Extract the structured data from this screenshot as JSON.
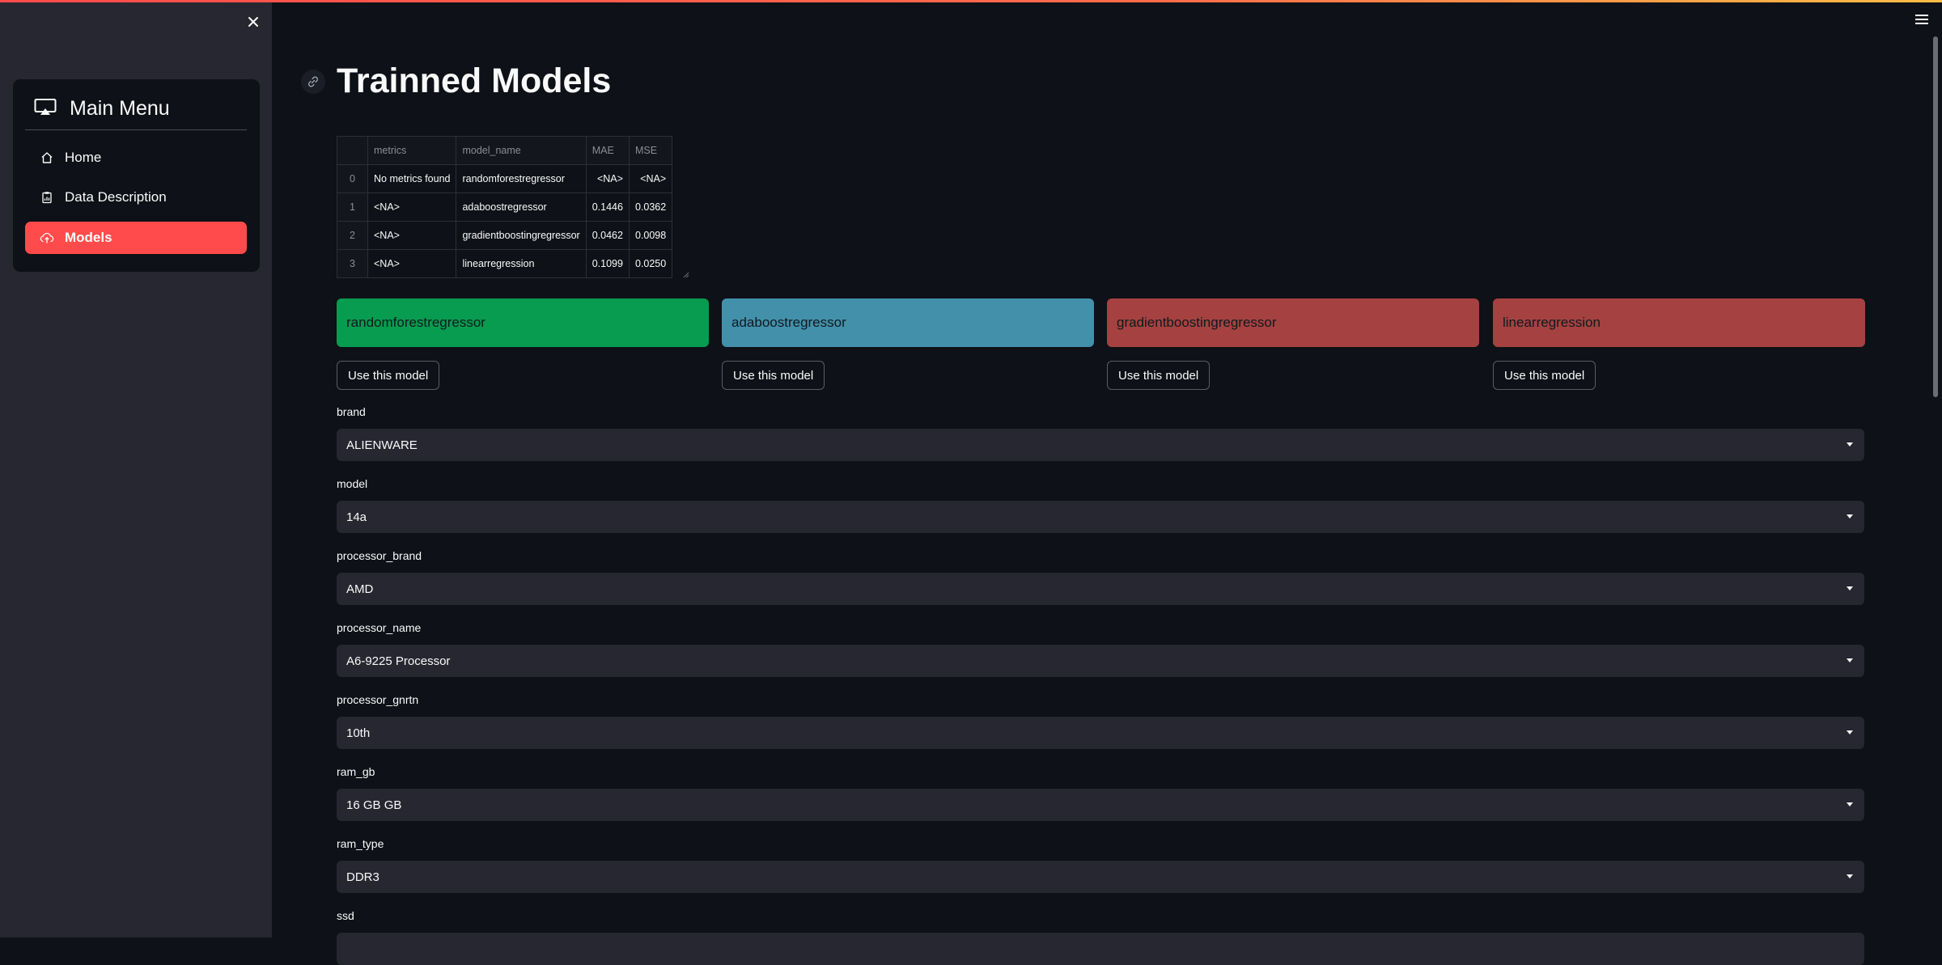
{
  "colors": {
    "accent": "#ff4b4b",
    "background": "#0e1117",
    "sidebar": "#262730",
    "card_green": "#079c4f",
    "card_blue": "#4390ab",
    "card_red": "#a64141"
  },
  "sidebar": {
    "close_icon": "close-icon",
    "menu": {
      "title": "Main Menu",
      "icon": "cast-icon",
      "items": [
        {
          "label": "Home",
          "icon": "house-icon",
          "active": false
        },
        {
          "label": "Data Description",
          "icon": "clipboard-data-icon",
          "active": false
        },
        {
          "label": "Models",
          "icon": "cloud-upload-icon",
          "active": true
        }
      ]
    }
  },
  "header": {
    "title": "Trainned Models",
    "link_icon": "link-icon",
    "menu_icon": "hamburger-icon"
  },
  "table": {
    "columns": [
      "",
      "metrics",
      "model_name",
      "MAE",
      "MSE"
    ],
    "rows": [
      [
        "0",
        "No metrics found",
        "randomforestregressor",
        "<NA>",
        "<NA>"
      ],
      [
        "1",
        "<NA>",
        "adaboostregressor",
        "0.1446",
        "0.0362"
      ],
      [
        "2",
        "<NA>",
        "gradientboostingregressor",
        "0.0462",
        "0.0098"
      ],
      [
        "3",
        "<NA>",
        "linearregression",
        "0.1099",
        "0.0250"
      ]
    ]
  },
  "models": [
    {
      "name": "randomforestregressor",
      "color": "#079c4f",
      "button_label": "Use this model"
    },
    {
      "name": "adaboostregressor",
      "color": "#4390ab",
      "button_label": "Use this model"
    },
    {
      "name": "gradientboostingregressor",
      "color": "#a64141",
      "button_label": "Use this model"
    },
    {
      "name": "linearregression",
      "color": "#a64141",
      "button_label": "Use this model"
    }
  ],
  "form": {
    "fields": [
      {
        "label": "brand",
        "value": "ALIENWARE"
      },
      {
        "label": "model",
        "value": "14a"
      },
      {
        "label": "processor_brand",
        "value": "AMD"
      },
      {
        "label": "processor_name",
        "value": "A6-9225 Processor"
      },
      {
        "label": "processor_gnrtn",
        "value": "10th"
      },
      {
        "label": "ram_gb",
        "value": "16 GB GB"
      },
      {
        "label": "ram_type",
        "value": "DDR3"
      },
      {
        "label": "ssd",
        "value": ""
      }
    ]
  }
}
